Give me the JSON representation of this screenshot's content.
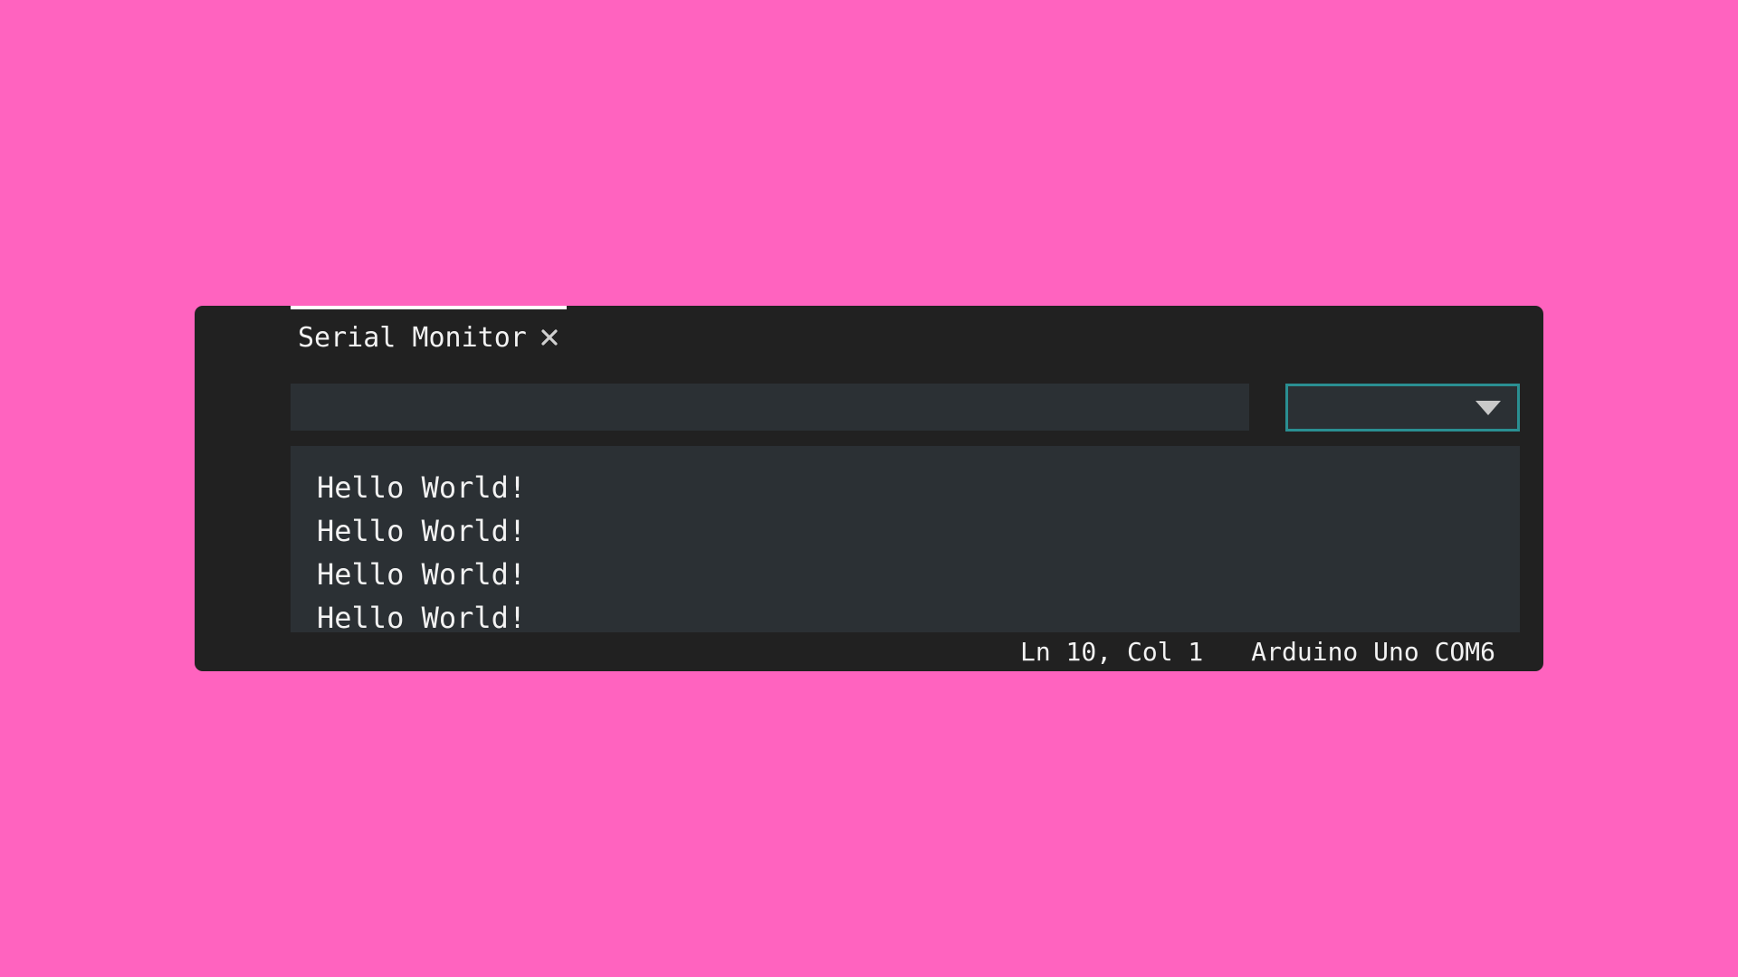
{
  "tabs": [
    {
      "label": "Serial Monitor",
      "active": true,
      "close_icon": "close-icon"
    }
  ],
  "message_input": {
    "value": "",
    "placeholder": ""
  },
  "baud_select": {
    "selected": "",
    "icon": "chevron-down-icon"
  },
  "output": {
    "lines": [
      "Hello World!",
      "Hello World!",
      "Hello World!",
      "Hello World!"
    ]
  },
  "status_bar": {
    "cursor_position": "Ln 10, Col 1",
    "board_port": "Arduino Uno COM6"
  },
  "colors": {
    "background": "#ff63bf",
    "window": "#212121",
    "panel": "#2b3034",
    "accent": "#2a8f92",
    "text": "#f2f2f2"
  }
}
